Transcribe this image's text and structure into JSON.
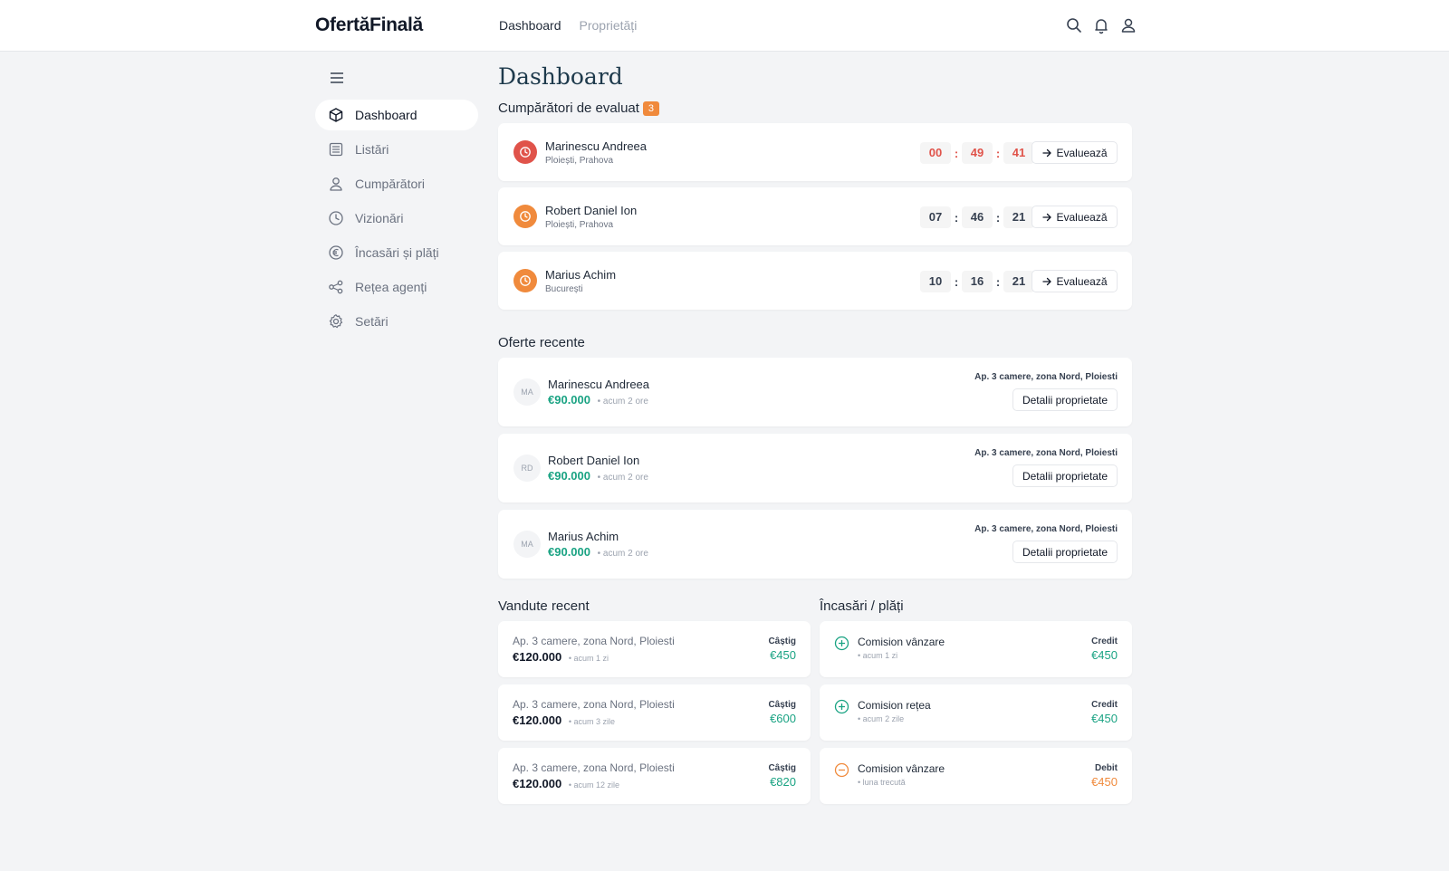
{
  "header": {
    "logo": "OfertăFinală",
    "nav": [
      "Dashboard",
      "Proprietăți"
    ]
  },
  "sidebar": {
    "items": [
      {
        "label": "Dashboard",
        "icon": "cube-icon",
        "active": true
      },
      {
        "label": "Listări",
        "icon": "list-icon"
      },
      {
        "label": "Cumpărători",
        "icon": "user-icon"
      },
      {
        "label": "Vizionări",
        "icon": "clock-icon"
      },
      {
        "label": "Încasări și plăți",
        "icon": "euro-icon"
      },
      {
        "label": "Rețea agenți",
        "icon": "share-icon"
      },
      {
        "label": "Setări",
        "icon": "gear-icon"
      }
    ]
  },
  "main": {
    "title": "Dashboard",
    "buyers_section": {
      "title": "Cumpărători de evaluat",
      "count": "3"
    },
    "buyers": [
      {
        "name": "Marinescu Andreea",
        "location": "Ploiești, Prahova",
        "h": "00",
        "m": "49",
        "s": "41",
        "status_color": "#e0534a",
        "button": "Evaluează"
      },
      {
        "name": "Robert Daniel Ion",
        "location": "Ploiești, Prahova",
        "h": "07",
        "m": "46",
        "s": "21",
        "status_color": "#f08a3c",
        "button": "Evaluează"
      },
      {
        "name": "Marius Achim",
        "location": "București",
        "h": "10",
        "m": "16",
        "s": "21",
        "status_color": "#f08a3c",
        "button": "Evaluează"
      }
    ],
    "offers_section": {
      "title": "Oferte recente"
    },
    "offers": [
      {
        "initials": "MA",
        "name": "Marinescu Andreea",
        "price": "€90.000",
        "time": "• acum 2 ore",
        "property": "Ap. 3 camere, zona Nord, Ploiesti",
        "button": "Detalii proprietate"
      },
      {
        "initials": "RD",
        "name": "Robert Daniel Ion",
        "price": "€90.000",
        "time": "• acum 2 ore",
        "property": "Ap. 3 camere, zona Nord, Ploiesti",
        "button": "Detalii proprietate"
      },
      {
        "initials": "MA",
        "name": "Marius Achim",
        "price": "€90.000",
        "time": "• acum 2 ore",
        "property": "Ap. 3 camere, zona Nord, Ploiesti",
        "button": "Detalii proprietate"
      }
    ],
    "sold_section": {
      "title": "Vandute recent"
    },
    "sold": [
      {
        "property": "Ap. 3 camere, zona Nord, Ploiesti",
        "price": "€120.000",
        "time": "• acum 1 zi",
        "gain_label": "Câștig",
        "gain": "€450"
      },
      {
        "property": "Ap. 3 camere, zona Nord, Ploiesti",
        "price": "€120.000",
        "time": "• acum 3 zile",
        "gain_label": "Câștig",
        "gain": "€600"
      },
      {
        "property": "Ap. 3 camere, zona Nord, Ploiesti",
        "price": "€120.000",
        "time": "• acum 12 zile",
        "gain_label": "Câștig",
        "gain": "€820"
      }
    ],
    "payments_section": {
      "title": "Încasări / plăți"
    },
    "payments": [
      {
        "name": "Comision vânzare",
        "time": "• acum 1 zi",
        "type": "Credit",
        "amount": "€450",
        "icon": "plus-circle-icon"
      },
      {
        "name": "Comision rețea",
        "time": "• acum 2 zile",
        "type": "Credit",
        "amount": "€450",
        "icon": "plus-circle-icon"
      },
      {
        "name": "Comision vânzare",
        "time": "• luna trecută",
        "type": "Debit",
        "amount": "€450",
        "icon": "minus-circle-icon"
      }
    ]
  },
  "colors": {
    "accent_green": "#1aa383",
    "accent_orange": "#f08a3c",
    "accent_red": "#e0534a",
    "title": "#1e3a4c"
  }
}
